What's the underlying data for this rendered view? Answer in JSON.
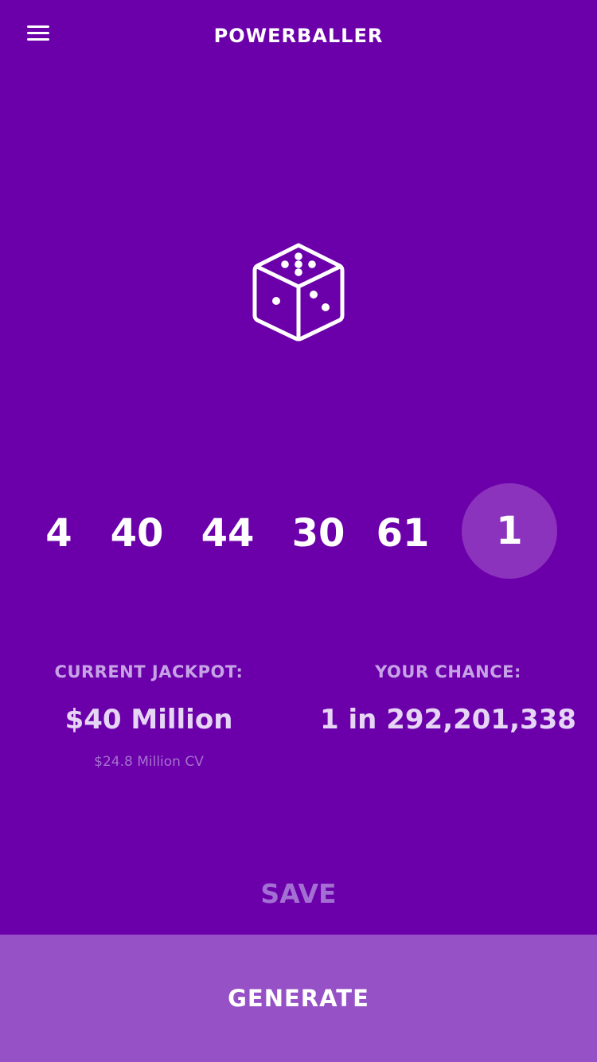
{
  "header": {
    "title": "POWERBALLER",
    "menu_icon": "hamburger-menu-icon"
  },
  "dice": {
    "icon": "dice-icon"
  },
  "numbers": {
    "white_balls": [
      "4",
      "40",
      "44",
      "30",
      "61"
    ],
    "powerball": "1"
  },
  "jackpot": {
    "label": "CURRENT JACKPOT:",
    "value": "$40 Million",
    "cash_value": "$24.8 Million CV"
  },
  "chance": {
    "label": "YOUR CHANCE:",
    "value": "1 in 292,201,338"
  },
  "actions": {
    "save_label": "SAVE",
    "generate_label": "GENERATE"
  },
  "colors": {
    "background": "#6b00aa",
    "powerball_circle": "#8c33bd",
    "generate_bar": "#9651c6",
    "muted_text": "#c7a3e6",
    "save_text": "#a36fd3"
  }
}
